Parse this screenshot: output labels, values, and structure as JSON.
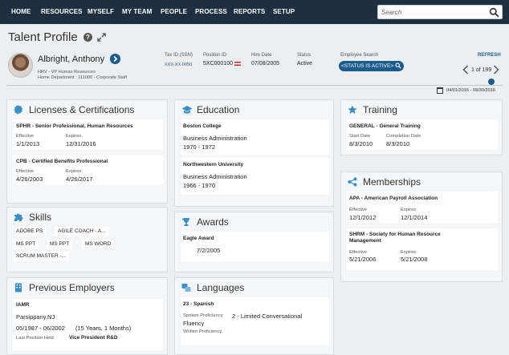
{
  "nav": {
    "items": [
      "HOME",
      "RESOURCES",
      "MYSELF",
      "MY TEAM",
      "PEOPLE",
      "PROCESS",
      "REPORTS",
      "SETUP"
    ],
    "search_placeholder": "Search"
  },
  "header": {
    "title": "Talent Profile",
    "employee_name": "Albright, Anthony",
    "job": "HRV - VP Human Resources",
    "home_department": "Home Department : 111000 - Corporate Staff",
    "tax_id_label": "Tax ID (SSN)",
    "tax_id_value": "XXX-XX-0050",
    "position_id_label": "Position ID",
    "position_id_value": "5XC000100",
    "hire_date_label": "Hire Date",
    "hire_date_value": "07/08/2005",
    "status_label": "Status",
    "status_value": "Active",
    "employee_search_label": "Employee Search",
    "employee_search_value": "<STATUS IS ACTIVE>",
    "refresh_label": "REFRESH",
    "pager_text": "1 of 199",
    "date_range": "04/01/2016 - 09/30/2016"
  },
  "licenses": {
    "title": "Licenses & Certifications",
    "items": [
      {
        "name": "SPHR - Senior Professional, Human Resources",
        "effective_label": "Effective",
        "effective": "1/1/2013",
        "expires_label": "Expires",
        "expires": "12/31/2016"
      },
      {
        "name": "CPB - Certified Benefits Professional",
        "effective_label": "Effective",
        "effective": "4/26/2003",
        "expires_label": "Expires",
        "expires": "4/26/2017"
      }
    ]
  },
  "skills": {
    "title": "Skills",
    "chips": [
      "ADOBE PS",
      "AGILE COACH - A...",
      "MS PPT",
      "MS PPT",
      "MS WORD",
      "SCRUM MASTER -..."
    ]
  },
  "previous_employers": {
    "title": "Previous Employers",
    "company": "IAMR",
    "location": "Parsippany,NJ",
    "dates": "05/1987 - 06/2002",
    "duration": "(15 Years, 1 Months)",
    "last_position_label": "Last Position Held",
    "last_position": "Vice President R&D"
  },
  "education": {
    "title": "Education",
    "items": [
      {
        "school": "Boston College",
        "field": "Business Administration",
        "years": "1970 - 1972"
      },
      {
        "school": "Northwestern University",
        "field": "Business Administration",
        "years": "1966 - 1970"
      }
    ]
  },
  "awards": {
    "title": "Awards",
    "name": "Eagle Award",
    "date": "7/2/2005"
  },
  "languages": {
    "title": "Languages",
    "name": "23 - Spanish",
    "spoken_label": "Spoken Proficiency",
    "spoken_value": "2 - Limited Conversational",
    "fluency_label": "Fluency",
    "written_label": "Written Proficiency"
  },
  "training": {
    "title": "Training",
    "name": "GENERAL - General Training",
    "start_label": "Start Date",
    "start": "8/3/2010",
    "completion_label": "Completion Date",
    "completion": "8/3/2010"
  },
  "memberships": {
    "title": "Memberships",
    "items": [
      {
        "name": "APA - American Payroll Association",
        "effective_label": "Effective",
        "effective": "12/1/2012",
        "expires_label": "Expires",
        "expires": "12/1/2014"
      },
      {
        "name": "SHRM - Society for Human Resource Management",
        "effective_label": "Effective",
        "effective": "5/21/2006",
        "expires_label": "Expires",
        "expires": "5/21/2008"
      }
    ]
  },
  "colors": {
    "nav_bg": "#1e2f42",
    "accent": "#1a5c8c",
    "card_bg": "#f5f6f7",
    "page_bg": "#eceef0"
  }
}
